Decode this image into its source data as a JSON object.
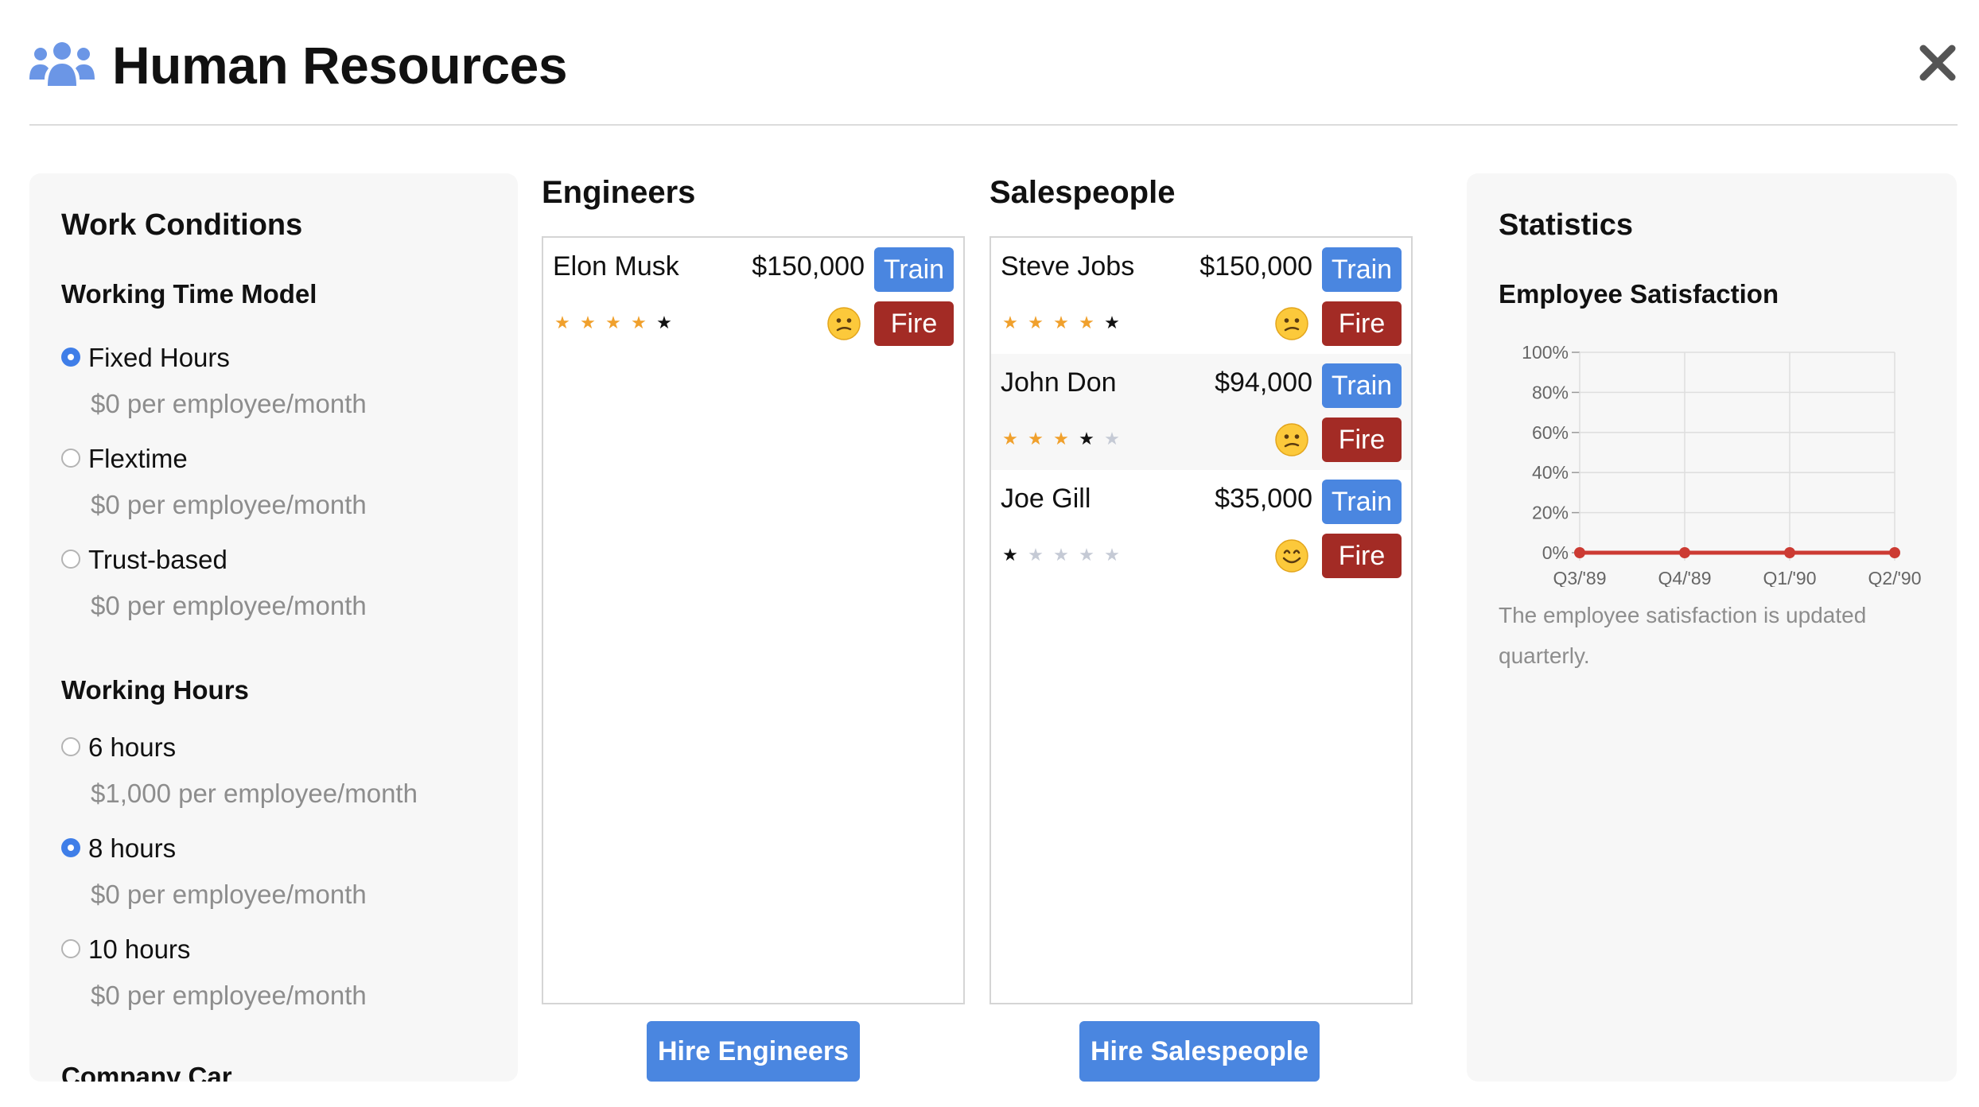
{
  "header": {
    "title": "Human Resources",
    "icon": "users-icon",
    "close_icon": "close-icon"
  },
  "work_conditions": {
    "title": "Work Conditions",
    "working_time_model": {
      "title": "Working Time Model",
      "options": [
        {
          "label": "Fixed Hours",
          "cost": "$0 per employee/month",
          "selected": true
        },
        {
          "label": "Flextime",
          "cost": "$0 per employee/month",
          "selected": false
        },
        {
          "label": "Trust-based",
          "cost": "$0 per employee/month",
          "selected": false
        }
      ]
    },
    "working_hours": {
      "title": "Working Hours",
      "options": [
        {
          "label": "6 hours",
          "cost": "$1,000 per employee/month",
          "selected": false
        },
        {
          "label": "8 hours",
          "cost": "$0 per employee/month",
          "selected": true
        },
        {
          "label": "10 hours",
          "cost": "$0 per employee/month",
          "selected": false
        }
      ]
    },
    "company_car": {
      "title": "Company Car"
    }
  },
  "engineers": {
    "title": "Engineers",
    "hire_label": "Hire Engineers",
    "employees": [
      {
        "name": "Elon Musk",
        "salary": "$150,000",
        "train_label": "Train",
        "fire_label": "Fire",
        "rating": 4,
        "max_rating": 5,
        "mood": "neutral"
      }
    ]
  },
  "salespeople": {
    "title": "Salespeople",
    "hire_label": "Hire Salespeople",
    "employees": [
      {
        "name": "Steve Jobs",
        "salary": "$150,000",
        "train_label": "Train",
        "fire_label": "Fire",
        "rating": 4,
        "max_rating": 5,
        "mood": "neutral"
      },
      {
        "name": "John Don",
        "salary": "$94,000",
        "train_label": "Train",
        "fire_label": "Fire",
        "rating": 3,
        "max_rating": 5,
        "mood": "neutral"
      },
      {
        "name": "Joe Gill",
        "salary": "$35,000",
        "train_label": "Train",
        "fire_label": "Fire",
        "rating": 0,
        "max_rating": 5,
        "mood": "happy"
      }
    ]
  },
  "statistics": {
    "title": "Statistics",
    "chart_title": "Employee Satisfaction",
    "note": "The employee satisfaction is updated quarterly."
  },
  "chart_data": {
    "type": "line",
    "title": "Employee Satisfaction",
    "categories": [
      "Q3/'89",
      "Q4/'89",
      "Q1/'90",
      "Q2/'90"
    ],
    "series": [
      {
        "values": [
          0,
          0,
          0,
          0
        ],
        "color": "#cc3b33"
      }
    ],
    "y_ticks": [
      "0%",
      "20%",
      "40%",
      "60%",
      "80%",
      "100%"
    ],
    "ylim": [
      0,
      100
    ],
    "grid": true
  },
  "colors": {
    "accent": "#4a86e0",
    "danger": "#a32b25",
    "star": "#f0a02c",
    "line": "#cc3b33"
  }
}
